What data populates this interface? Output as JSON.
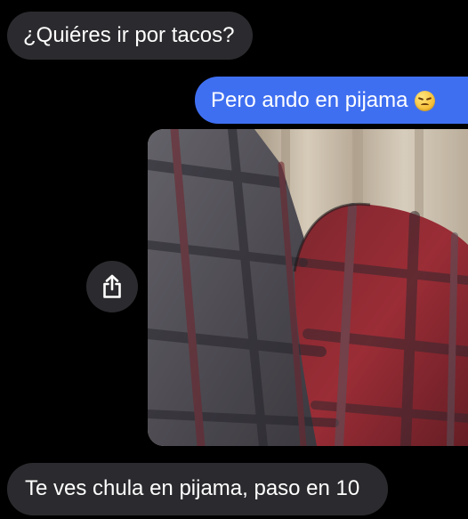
{
  "conversation": {
    "messages": [
      {
        "sender": "incoming",
        "text": "¿Quiéres ir por tacos?"
      },
      {
        "sender": "outgoing",
        "text": "Pero ando en pijama",
        "emoji": "disappointed-face"
      },
      {
        "sender": "outgoing",
        "type": "photo",
        "description_icon": "photo-attachment"
      },
      {
        "sender": "incoming",
        "text": "Te ves chula en pijama, paso en 10"
      }
    ]
  },
  "actions": {
    "share_icon": "share-icon"
  },
  "colors": {
    "background": "#000000",
    "incoming_bubble": "#2b2b2f",
    "outgoing_bubble": "#3f6ff1",
    "text": "#ffffff"
  }
}
